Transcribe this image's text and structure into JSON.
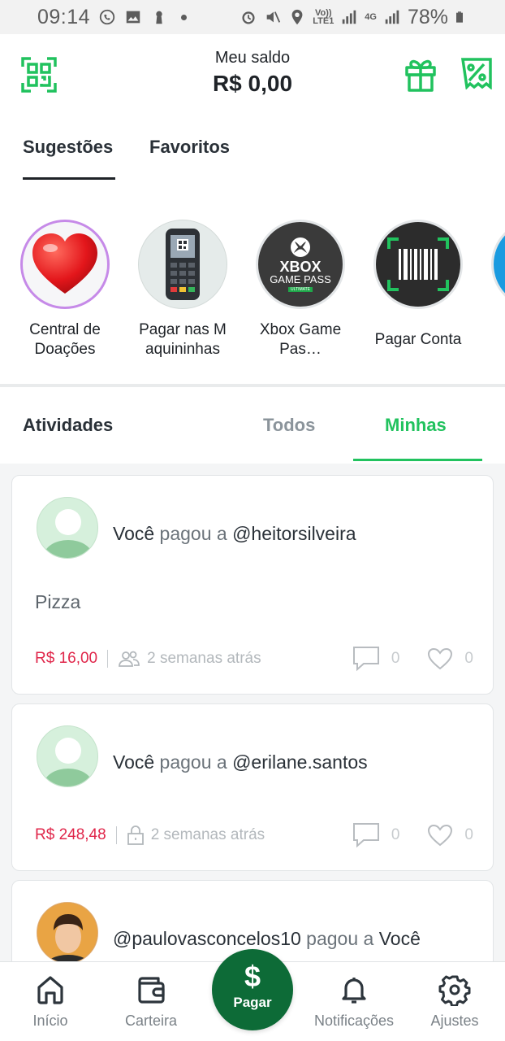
{
  "status_bar": {
    "time": "09:14",
    "battery": "78%",
    "net_small_1": "Vo)) LTE1",
    "net_small_2": "4G"
  },
  "header": {
    "balance_label": "Meu saldo",
    "balance_value": "R$ 0,00",
    "accent": "#21c25e"
  },
  "suggest_tabs": {
    "suggestions": "Sugestões",
    "favorites": "Favoritos"
  },
  "suggestions": [
    {
      "label": "Central de Doações",
      "icon": "heart-icon"
    },
    {
      "label": "Pagar nas M aquininhas",
      "icon": "card-machine-icon"
    },
    {
      "label": "Xbox Game Pas…",
      "icon": "xbox-gamepass-icon",
      "logo_text_1": "XBOX",
      "logo_text_2": "GAME PASS",
      "logo_text_3": "ULTIMATE"
    },
    {
      "label": "Pagar Conta",
      "icon": "barcode-icon"
    }
  ],
  "activity": {
    "title": "Atividades",
    "tab_all": "Todos",
    "tab_mine": "Minhas"
  },
  "feed": [
    {
      "actor": "Você",
      "verb": "pagou a",
      "target": "@heitorsilveira",
      "description": "Pizza",
      "amount": "R$ 16,00",
      "privacy": "people-icon",
      "time": "2 semanas atrás",
      "comments": "0",
      "likes": "0"
    },
    {
      "actor": "Você",
      "verb": "pagou a",
      "target": "@erilane.santos",
      "description": "",
      "amount": "R$ 248,48",
      "privacy": "lock-icon",
      "time": "2 semanas atrás",
      "comments": "0",
      "likes": "0"
    },
    {
      "actor": "@paulovasconcelos10",
      "verb": "pagou a",
      "target": "Você"
    }
  ],
  "bottom_nav": {
    "home": "Início",
    "wallet": "Carteira",
    "pay_symbol": "$",
    "pay": "Pagar",
    "notifications": "Notificações",
    "settings": "Ajustes"
  }
}
